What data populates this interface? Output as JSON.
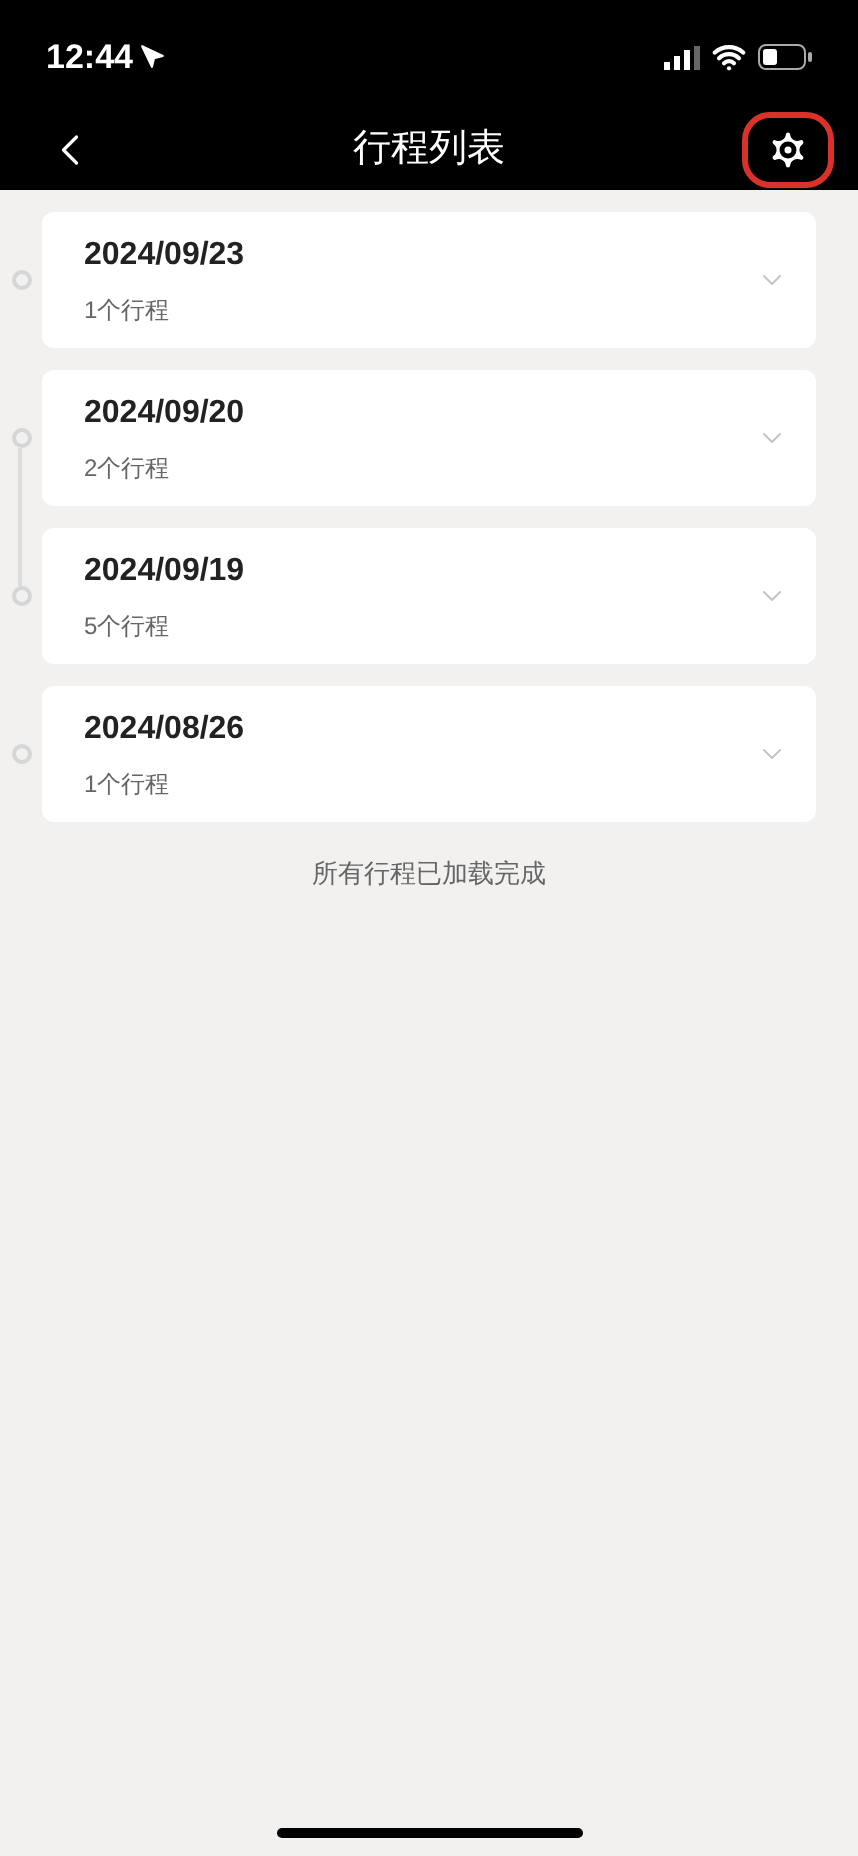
{
  "status_bar": {
    "time": "12:44"
  },
  "nav": {
    "title": "行程列表",
    "settings_highlighted": true
  },
  "days": [
    {
      "date": "2024/09/23",
      "count": "1个行程",
      "linked_to_next": false
    },
    {
      "date": "2024/09/20",
      "count": "2个行程",
      "linked_to_next": true
    },
    {
      "date": "2024/09/19",
      "count": "5个行程",
      "linked_to_next": false
    },
    {
      "date": "2024/08/26",
      "count": "1个行程",
      "linked_to_next": false
    }
  ],
  "footer": "所有行程已加载完成"
}
